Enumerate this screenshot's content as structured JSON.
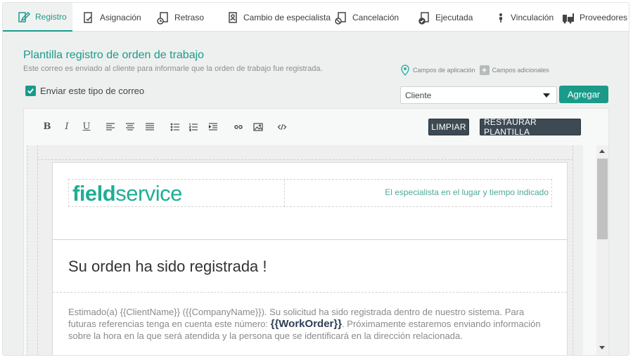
{
  "tabs": [
    {
      "label": "Registro",
      "icon": "registro-icon",
      "active": true
    },
    {
      "label": "Asignación",
      "icon": "asignacion-icon"
    },
    {
      "label": "Retraso",
      "icon": "retraso-icon"
    },
    {
      "label": "Cambio de especialista",
      "icon": "cambio-especialista-icon"
    },
    {
      "label": "Cancelación",
      "icon": "cancelacion-icon"
    },
    {
      "label": "Ejecutada",
      "icon": "ejecutada-icon"
    },
    {
      "label": "Vinculación",
      "icon": "vinculacion-icon"
    },
    {
      "label": "Proveedores",
      "icon": "proveedores-icon"
    }
  ],
  "header": {
    "title": "Plantilla registro de orden de trabajo",
    "subtitle": "Este correo es enviado al cliente para informarle que la orden de trabajo fue registrada."
  },
  "legend": {
    "application_fields": "Campos de aplicación",
    "additional_fields": "Campos adicionales"
  },
  "checkbox": {
    "label": "Enviar este tipo de correo",
    "checked": true
  },
  "select": {
    "value": "Cliente"
  },
  "add_button": "Agregar",
  "toolbar": {
    "bold": "B",
    "italic": "I",
    "underline": "U",
    "clear_button": "LIMPIAR",
    "restore_button": "RESTAURAR PLANTILLA"
  },
  "mail": {
    "logo_bold": "field",
    "logo_light": "service",
    "tagline": "El especialista en el lugar y tiempo indicado",
    "title": "Su orden ha sido registrada !",
    "body_1": "Estimado(a) {{ClientName}} ({{CompanyName}}). Su solicitud ha sido registrada dentro de nuestro sistema. Para futuras referencias tenga en cuenta este número: ",
    "body_token": "{{WorkOrder}}",
    "body_2": ". Próximamente estaremos enviando información sobre la hora en la que será atendida y la persona que se identificará en la dirección relacionada."
  },
  "colors": {
    "accent": "#1a9b8a",
    "dark_button": "#3d4a54",
    "logo": "#1fae95"
  }
}
